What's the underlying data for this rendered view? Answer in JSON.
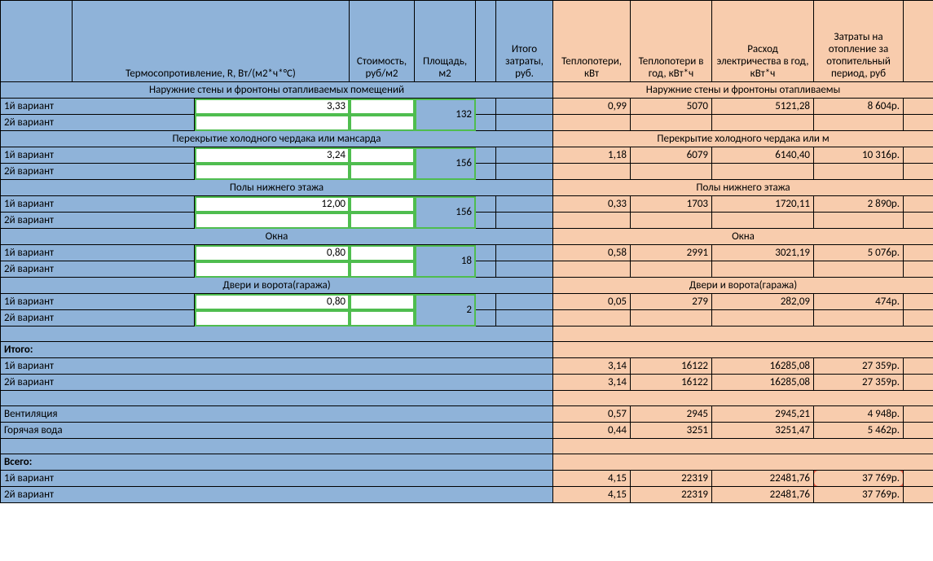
{
  "headers": {
    "r": "Термосопротивление, R, Вт/(м2*ч*°С)",
    "cost": "Стоимость, руб/м2",
    "area": "Площадь, м2",
    "tot": "Итого затраты, руб.",
    "hl": "Теплопотери, кВт",
    "hly": "Теплопотери в год, кВт*ч",
    "elec": "Расход электричества в год, кВт*ч",
    "heat": "Затраты на отопление за отопительный период, руб"
  },
  "labels": {
    "v1": "1й вариант",
    "v2": "2й вариант",
    "itogo": "Итого:",
    "vent": "Вентиляция",
    "hot": "Горячая вода",
    "vsego": "Всего:"
  },
  "sections": {
    "s0": {
      "titleL": "Наружние стены и фронтоны отапливаемых помещений",
      "titleR": "Наружние стены и фронтоны отапливаемы",
      "r": "3,33",
      "area": "132",
      "hl": "0,99",
      "hly": "5070",
      "elec": "5121,28",
      "heat": "8 604р."
    },
    "s1": {
      "titleL": "Перекрытие холодного чердака или мансарда",
      "titleR": "Перекрытие холодного чердака или м",
      "r": "3,24",
      "area": "156",
      "hl": "1,18",
      "hly": "6079",
      "elec": "6140,40",
      "heat": "10 316р."
    },
    "s2": {
      "titleL": "Полы нижнего этажа",
      "titleR": "Полы нижнего этажа",
      "r": "12,00",
      "area": "156",
      "hl": "0,33",
      "hly": "1703",
      "elec": "1720,11",
      "heat": "2 890р."
    },
    "s3": {
      "titleL": "Окна",
      "titleR": "Окна",
      "r": "0,80",
      "area": "18",
      "hl": "0,58",
      "hly": "2991",
      "elec": "3021,19",
      "heat": "5 076р."
    },
    "s4": {
      "titleL": "Двери и ворота(гаража)",
      "titleR": "Двери и ворота(гаража)",
      "r": "0,80",
      "area": "2",
      "hl": "0,05",
      "hly": "279",
      "elec": "282,09",
      "heat": "474р."
    }
  },
  "itogo": {
    "v1": {
      "hl": "3,14",
      "hly": "16122",
      "elec": "16285,08",
      "heat": "27 359р."
    },
    "v2": {
      "hl": "3,14",
      "hly": "16122",
      "elec": "16285,08",
      "heat": "27 359р."
    }
  },
  "extra": {
    "vent": {
      "hl": "0,57",
      "hly": "2945",
      "elec": "2945,21",
      "heat": "4 948р."
    },
    "hot": {
      "hl": "0,44",
      "hly": "3251",
      "elec": "3251,47",
      "heat": "5 462р."
    }
  },
  "vsego": {
    "v1": {
      "hl": "4,15",
      "hly": "22319",
      "elec": "22481,76",
      "heat": "37 769р."
    },
    "v2": {
      "hl": "4,15",
      "hly": "22319",
      "elec": "22481,76",
      "heat": "37 769р."
    }
  }
}
